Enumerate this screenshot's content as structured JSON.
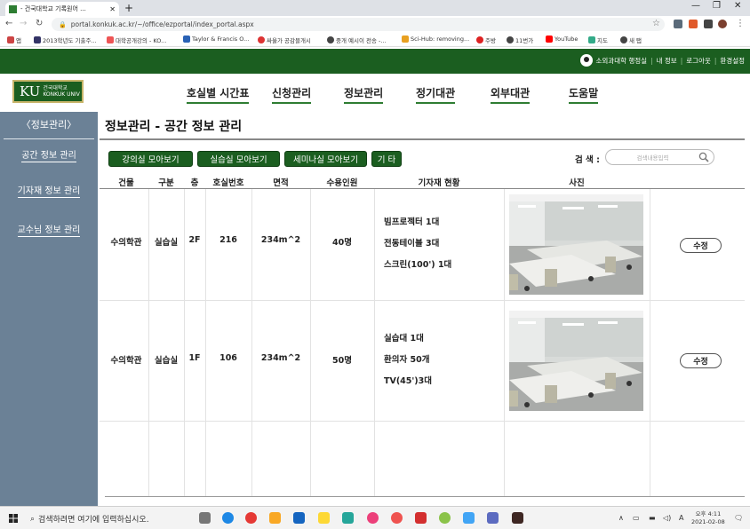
{
  "browser": {
    "tab_title": "- 건국대학교 기록원어 ...",
    "url": "portal.konkuk.ac.kr/~/office/ezportal/index_portal.aspx",
    "bookmarks": [
      "앱",
      "2013학년도 기출주...",
      "대학공개강의 - KO...",
      "Taylor & Francis O...",
      "싸울가 공감블개시",
      "중개 예시이 전송 -...",
      "Sci-Hub: removing...",
      "주방",
      "11번가",
      "YouTube",
      "지도",
      "새 탭"
    ]
  },
  "user_bar": {
    "name": "소외과대학 행정실",
    "links": [
      "내 정보",
      "로그아웃",
      "환경설정"
    ]
  },
  "logo": {
    "mark": "KU",
    "name_ko": "건국대학교",
    "name_en": "KONKUK UNIV"
  },
  "nav": [
    "호실별 시간표",
    "신청관리",
    "정보관리",
    "정기대관",
    "외부대관",
    "도움말"
  ],
  "sidebar": {
    "header": "〈정보관리〉",
    "items": [
      "공간 정보 관리",
      "기자재 정보 관리",
      "교수님 정보 관리"
    ]
  },
  "page_title": "정보관리 - 공간 정보 관리",
  "categories": [
    "강의실 모아보기",
    "실습실 모아보기",
    "세미나실 모아보기",
    "기 타"
  ],
  "search": {
    "label": "검 색 :",
    "placeholder": "검색내용입력"
  },
  "table": {
    "headers": [
      "건물",
      "구분",
      "층",
      "호실번호",
      "면적",
      "수용인원",
      "기자재 현황",
      "사진"
    ],
    "rows": [
      {
        "building": "수의학관",
        "type": "실습실",
        "floor": "2F",
        "room": "216",
        "area": "234m^2",
        "capacity": "40명",
        "equipment": [
          "빔프로젝터 1대",
          "전동테이블 3대",
          "스크린(100') 1대"
        ],
        "edit": "수정"
      },
      {
        "building": "수의학관",
        "type": "실습실",
        "floor": "1F",
        "room": "106",
        "area": "234m^2",
        "capacity": "50명",
        "equipment": [
          "실습대 1대",
          "환의자 50개",
          "TV(45')3대"
        ],
        "edit": "수정"
      }
    ]
  },
  "taskbar": {
    "search": "검색하려면 여기에 입력하십시오.",
    "time": "오후 4:11",
    "date": "2021-02-08"
  },
  "colors": {
    "green": "#1b5e20",
    "sidebar": "#6b8196"
  }
}
